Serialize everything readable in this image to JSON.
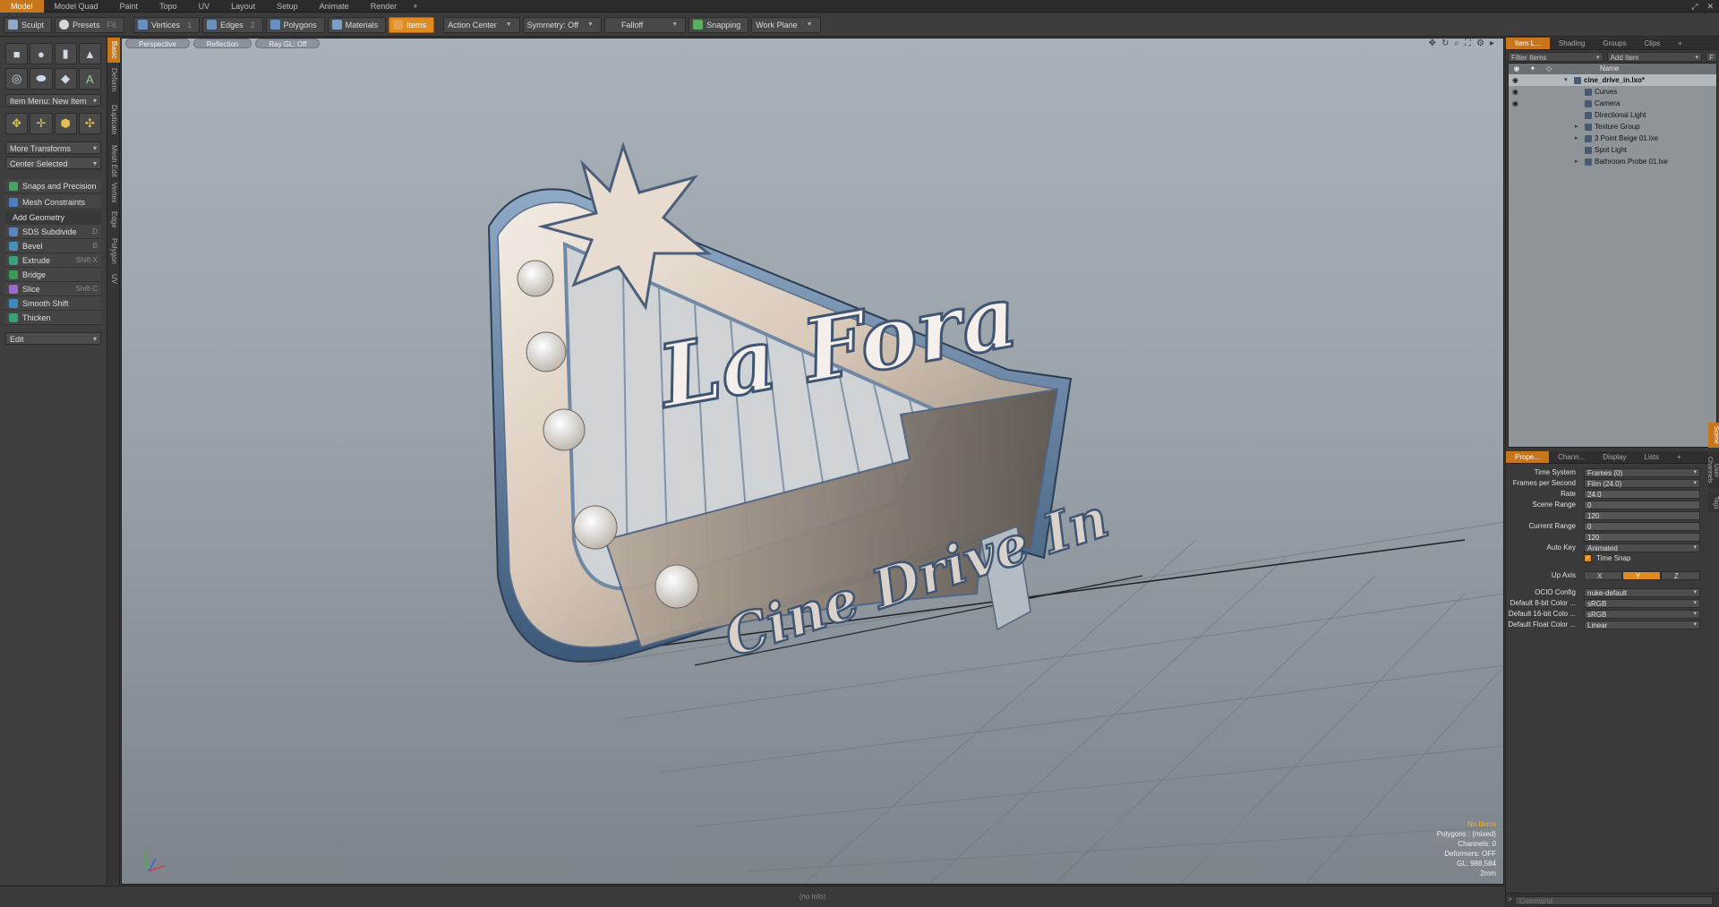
{
  "menu_tabs": [
    "Model",
    "Model Quad",
    "Paint",
    "Topo",
    "UV",
    "Layout",
    "Setup",
    "Animate",
    "Render"
  ],
  "menu_plus": "+",
  "toolbar": {
    "sculpt": "Sculpt",
    "presets": "Presets",
    "presets_key": "F6",
    "vertices": "Vertices",
    "vertices_key": "1",
    "edges": "Edges",
    "edges_key": "2",
    "polygons": "Polygons",
    "materials": "Materials",
    "items": "Items",
    "action_center": "Action Center",
    "symmetry": "Symmetry: Off",
    "falloff": "Falloff",
    "snapping": "Snapping",
    "work_plane": "Work Plane"
  },
  "left_panel": {
    "item_menu": "Item Menu: New Item",
    "more_transforms": "More Transforms",
    "center_selected": "Center Selected",
    "snaps": "Snaps and Precision",
    "mesh_constraints": "Mesh Constraints",
    "add_geometry": "Add Geometry",
    "tools": [
      {
        "label": "SDS Subdivide",
        "key": "D",
        "color": "#5a86c0"
      },
      {
        "label": "Bevel",
        "key": "B",
        "color": "#4a8fb8"
      },
      {
        "label": "Extrude",
        "key": "Shift-X",
        "color": "#3aa07a"
      },
      {
        "label": "Bridge",
        "key": "",
        "color": "#3d9a55"
      },
      {
        "label": "Slice",
        "key": "Shift-C",
        "color": "#9a6ac8"
      },
      {
        "label": "Smooth Shift",
        "key": "",
        "color": "#3a8ac0"
      },
      {
        "label": "Thicken",
        "key": "",
        "color": "#3aa070"
      }
    ],
    "edit": "Edit",
    "vtabs": [
      "Basic",
      "Deform",
      "Duplicate",
      "Mesh Edit",
      "Vertex",
      "Edge",
      "Polygon",
      "UV"
    ]
  },
  "viewport": {
    "perspective": "Perspective",
    "reflection": "Reflection",
    "raygl": "Ray GL: Off",
    "sign_main": "La Fora",
    "sign_sub": "Cine Drive In",
    "info": {
      "items": "No Items",
      "polygons": "Polygons : (mixed)",
      "channels": "Channels: 0",
      "deformers": "Deformers: OFF",
      "gl": "GL: 988,584",
      "scale": "2mm"
    },
    "status": "(no info)"
  },
  "right_panel": {
    "top_tabs": [
      "Item L...",
      "Shading",
      "Groups",
      "Clips"
    ],
    "top_plus": "+",
    "filter_items": "Filter Items",
    "add_item": "Add Item",
    "add_item_key": "F",
    "tree_header": "Name",
    "items": [
      {
        "label": "cine_drive_in.lxo*",
        "depth": 0,
        "eye": true,
        "expand": "▾",
        "sel": true
      },
      {
        "label": "Curves",
        "depth": 1,
        "eye": true,
        "expand": "",
        "sel": false
      },
      {
        "label": "Camera",
        "depth": 1,
        "eye": true,
        "expand": "",
        "sel": false
      },
      {
        "label": "Directional Light",
        "depth": 1,
        "eye": false,
        "expand": "",
        "sel": false
      },
      {
        "label": "Texture Group",
        "depth": 1,
        "eye": false,
        "expand": "▸",
        "sel": false
      },
      {
        "label": "3 Point Beige 01.lxe",
        "depth": 1,
        "eye": false,
        "expand": "▸",
        "sel": false
      },
      {
        "label": "Spot Light",
        "depth": 1,
        "eye": false,
        "expand": "",
        "sel": false
      },
      {
        "label": "Bathroom Probe 01.lxe",
        "depth": 1,
        "eye": false,
        "expand": "▸",
        "sel": false
      }
    ],
    "prop_tabs": [
      "Prope...",
      "Chann...",
      "Display",
      "Lists"
    ],
    "prop_plus": "+",
    "side_tabs": [
      "Scene",
      "User Channels",
      "Tags"
    ],
    "props": {
      "time_system_label": "Time System",
      "time_system": "Frames (0)",
      "fps_label": "Frames per Second",
      "fps": "Film (24.0)",
      "rate_label": "Rate",
      "rate": "24.0",
      "scene_range_label": "Scene Range",
      "scene_range_start": "0",
      "scene_range_end": "120",
      "current_range_label": "Current Range",
      "current_range_start": "0",
      "current_range_end": "120",
      "auto_key_label": "Auto Key",
      "auto_key": "Animated",
      "time_snap": "Time Snap",
      "up_axis_label": "Up Axis",
      "axis_x": "X",
      "axis_y": "Y",
      "axis_z": "Z",
      "ocio_label": "OCIO Config",
      "ocio": "nuke-default",
      "c8_label": "Default 8-bit Color ...",
      "c8": "sRGB",
      "c16_label": "Default 16-bit Colo ...",
      "c16": "sRGB",
      "cf_label": "Default Float Color ...",
      "cf": "Linear"
    },
    "command": "Command"
  },
  "colors": {
    "accent": "#e08a22",
    "panel": "#3a3a3a",
    "viewport_top": "#a8b0b8"
  }
}
